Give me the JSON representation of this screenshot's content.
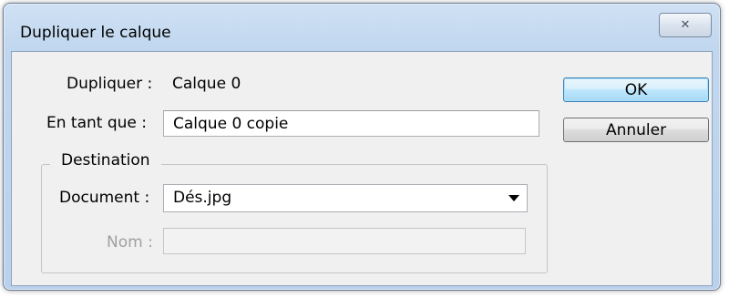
{
  "window": {
    "title": "Dupliquer le calque",
    "close_glyph": "✕"
  },
  "form": {
    "duplicate_label": "Dupliquer :",
    "duplicate_value": "Calque 0",
    "as_label": "En tant que :",
    "as_value": "Calque 0 copie"
  },
  "destination": {
    "legend": "Destination",
    "document_label": "Document :",
    "document_value": "Dés.jpg",
    "name_label": "Nom :",
    "name_value": ""
  },
  "buttons": {
    "ok": "OK",
    "cancel": "Annuler"
  },
  "colors": {
    "ok_border": "#3c7fb1",
    "frame": "#c1d7ef"
  },
  "icons": {
    "close": "close-icon",
    "dropdown": "chevron-down-icon"
  }
}
